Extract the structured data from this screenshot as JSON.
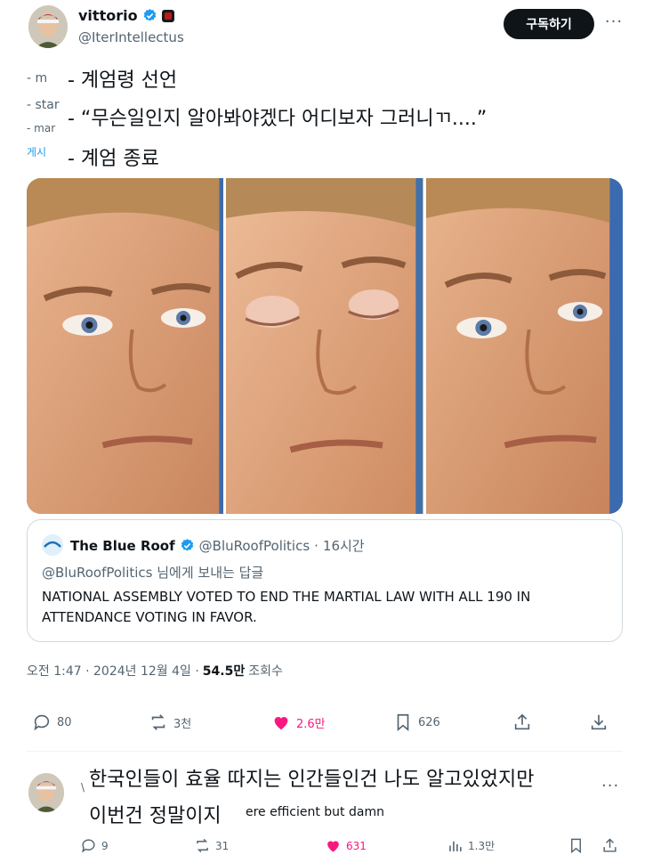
{
  "author": {
    "display_name": "vittorio",
    "handle": "@IterIntellectus"
  },
  "subscribe_label": "구독하기",
  "more_label": "···",
  "ghost_lines": [
    "- m",
    "- star",
    "- mar",
    "게시"
  ],
  "captions": [
    "- 계엄령 선언",
    "- “무슨일인지 알아봐야겠다 어디보자 그러니ㄲ....”",
    "- 계엄 종료"
  ],
  "quote": {
    "name": "The Blue Roof",
    "handle": "@BluRoofPolitics",
    "dot": "·",
    "time": "16시간",
    "reply_mention": "@BluRoofPolitics",
    "reply_suffix": " 님에게 보내는 답글",
    "text": "NATIONAL ASSEMBLY VOTED TO END THE MARTIAL LAW WITH ALL 190 IN ATTENDANCE VOTING IN FAVOR."
  },
  "meta": {
    "timestamp": "오전 1:47 · 2024년 12월 4일 ·",
    "views": "54.5만",
    "views_label": "조회수"
  },
  "actions": {
    "replies": "80",
    "reposts": "3천",
    "likes": "2.6만",
    "bookmarks": "626"
  },
  "reply": {
    "ghost": "\\",
    "line1": "한국인들이 효율 따지는 인간들인건 나도 알고있었지만",
    "line2": "이번건 정말이지",
    "english_fragment": "ere efficient but damn",
    "more": "···",
    "replies": "9",
    "reposts": "31",
    "likes": "631",
    "views": "1.3만"
  },
  "colors": {
    "accent": "#1d9bf0",
    "like": "#f91880",
    "text": "#0f1419",
    "muted": "#536471"
  }
}
